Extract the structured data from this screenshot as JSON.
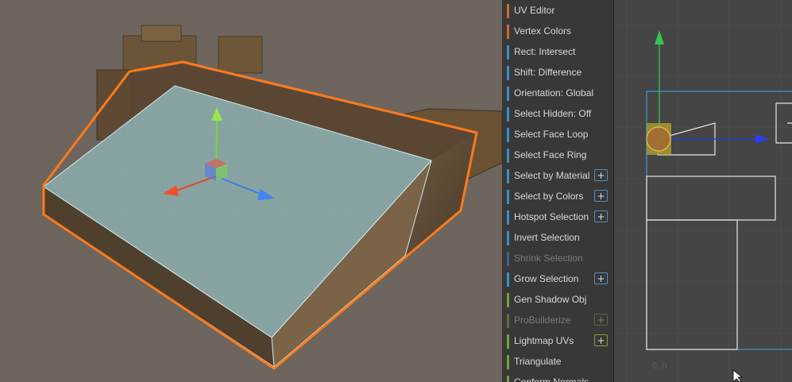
{
  "tools": [
    {
      "label": "UV Editor",
      "color": "#c86a33",
      "plus": false,
      "enabled": true
    },
    {
      "label": "Vertex Colors",
      "color": "#c86a33",
      "plus": false,
      "enabled": true
    },
    {
      "label": "Rect: Intersect",
      "color": "#3a8fc6",
      "plus": false,
      "enabled": true
    },
    {
      "label": "Shift: Difference",
      "color": "#3a8fc6",
      "plus": false,
      "enabled": true
    },
    {
      "label": "Orientation: Global",
      "color": "#3a8fc6",
      "plus": false,
      "enabled": true
    },
    {
      "label": "Select Hidden: Off",
      "color": "#3a8fc6",
      "plus": false,
      "enabled": true
    },
    {
      "label": "Select Face Loop",
      "color": "#3a8fc6",
      "plus": false,
      "enabled": true
    },
    {
      "label": "Select Face Ring",
      "color": "#3a8fc6",
      "plus": false,
      "enabled": true
    },
    {
      "label": "Select by Material",
      "color": "#3a8fc6",
      "plus": true,
      "enabled": true
    },
    {
      "label": "Select by Colors",
      "color": "#3a8fc6",
      "plus": true,
      "enabled": true
    },
    {
      "label": "Hotspot Selection",
      "color": "#3a8fc6",
      "plus": true,
      "enabled": true
    },
    {
      "label": "Invert Selection",
      "color": "#3a8fc6",
      "plus": false,
      "enabled": true
    },
    {
      "label": "Shrink Selection",
      "color": "#3a8fc6",
      "plus": false,
      "enabled": false
    },
    {
      "label": "Grow Selection",
      "color": "#3a8fc6",
      "plus": true,
      "enabled": true
    },
    {
      "label": "Gen Shadow Obj",
      "color": "#6fa33a",
      "plus": false,
      "enabled": true
    },
    {
      "label": "ProBuilderize",
      "color": "#6fa33a",
      "plus": true,
      "enabled": false
    },
    {
      "label": "Lightmap UVs",
      "color": "#6fa33a",
      "plus": true,
      "enabled": true
    },
    {
      "label": "Triangulate",
      "color": "#6fa33a",
      "plus": false,
      "enabled": true
    },
    {
      "label": "Conform Normals",
      "color": "#6fa33a",
      "plus": false,
      "enabled": true
    }
  ],
  "plus_symbol": "+",
  "uv_editor": {
    "coordinate_readout": "0, 0"
  },
  "scene": {
    "selection_outline_color": "#ff7a1a",
    "selected_face_color": "#8fb0b2"
  }
}
